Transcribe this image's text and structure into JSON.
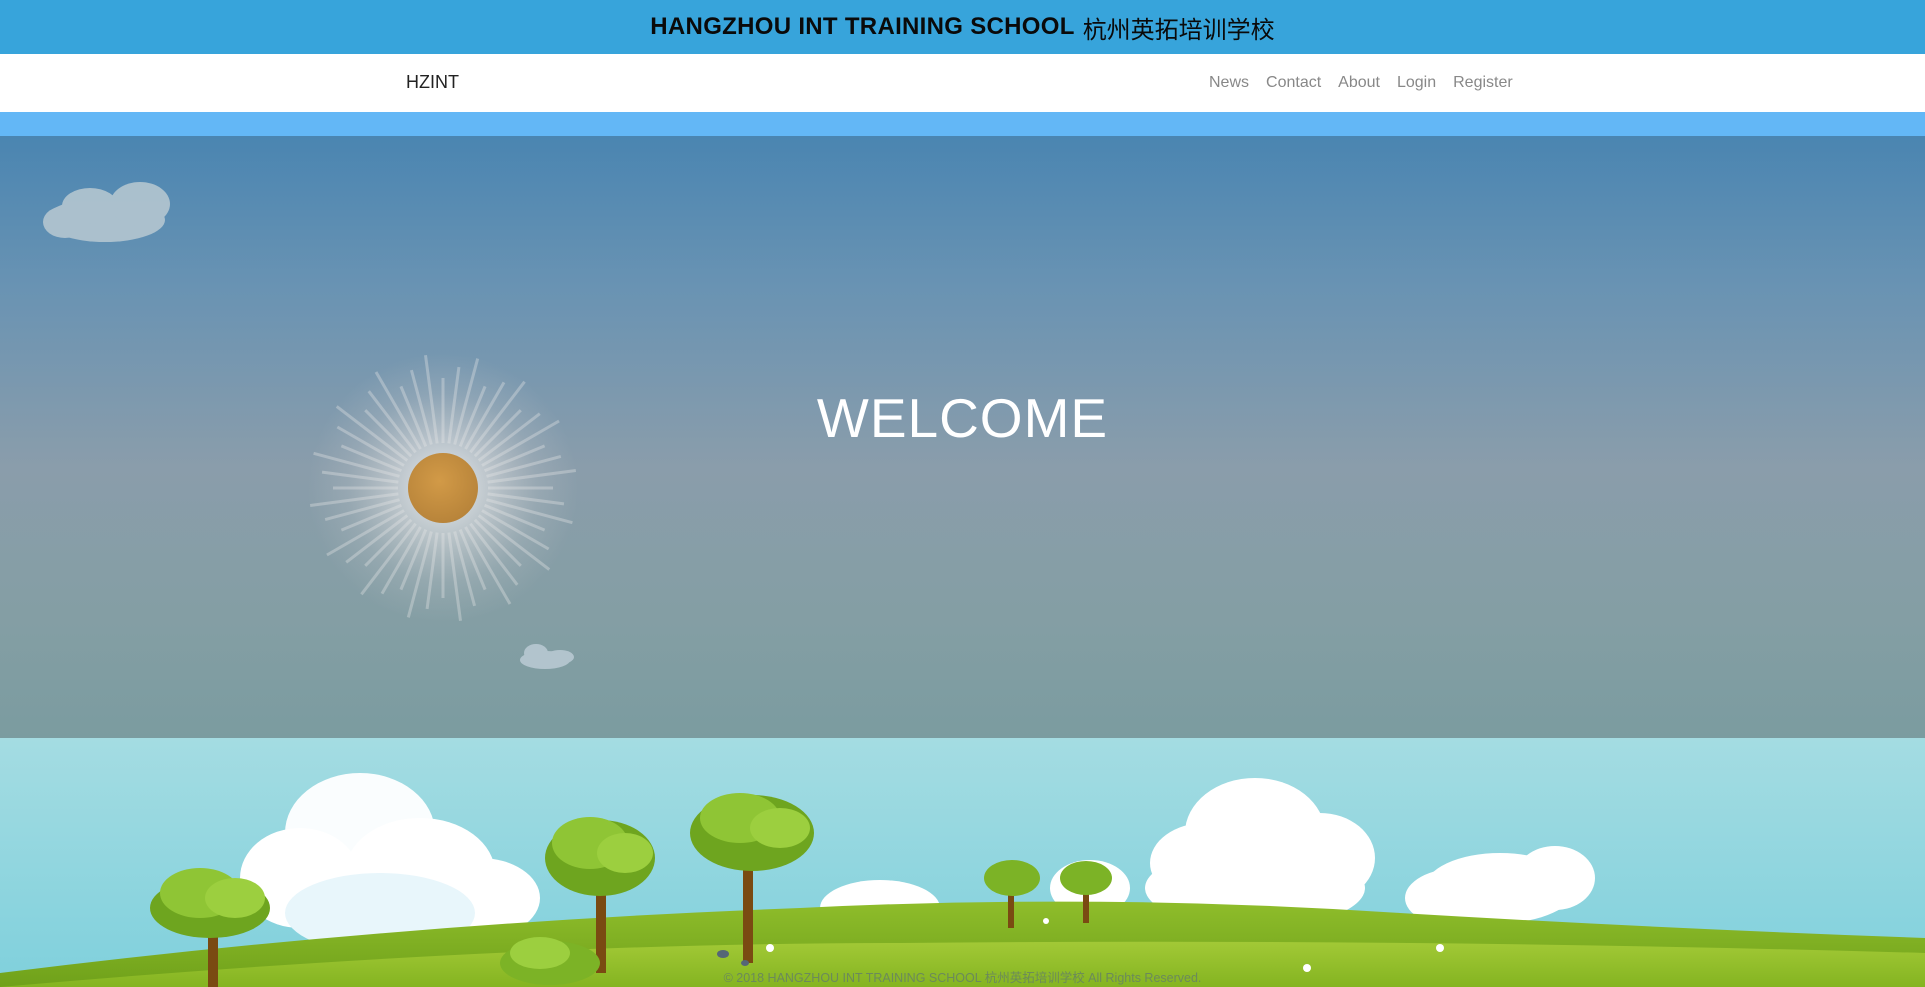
{
  "header": {
    "title": "HANGZHOU INT TRAINING SCHOOL",
    "title_cn": "杭州英拓培训学校",
    "background": "#37a4db"
  },
  "navbar": {
    "brand": "HZINT",
    "links": [
      "News",
      "Contact",
      "About",
      "Login",
      "Register"
    ]
  },
  "hero": {
    "welcome": "WELCOME",
    "sky_color": "#4a85b1",
    "sun_color": "#c08c3f"
  },
  "footer": {
    "copyright": "© 2018 HANGZHOU INT TRAINING SCHOOL 杭州英拓培训学校 All Rights Reserved."
  }
}
